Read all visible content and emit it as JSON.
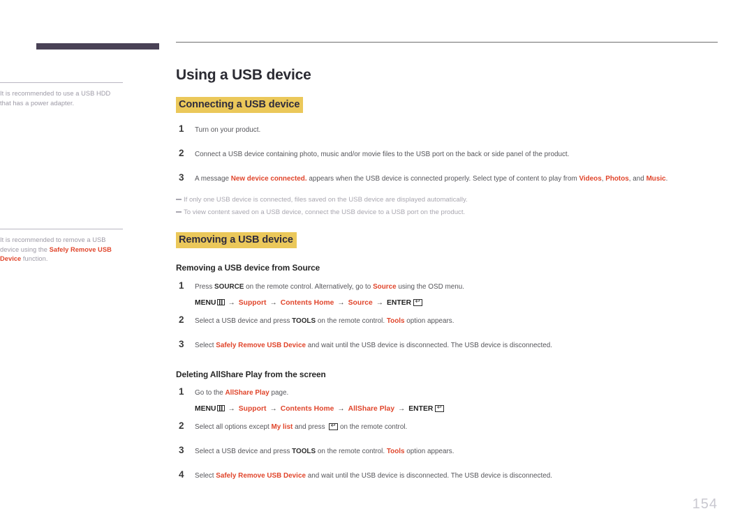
{
  "sidebar": {
    "notes": [
      {
        "id": "note-usb-hdd",
        "pre": "It is recommended to use a USB HDD that has a power adapter.",
        "accent": "",
        "post": ""
      },
      {
        "id": "note-safely-remove",
        "pre": "It is recommended to remove a USB device using the ",
        "accent": "Safely Remove USB Device",
        "post": " function."
      }
    ]
  },
  "page": {
    "title": "Using a USB device",
    "number": "154"
  },
  "sections": {
    "connecting": {
      "heading": "Connecting a USB device",
      "steps": [
        {
          "num": "1",
          "parts": [
            {
              "t": "Turn on your product.",
              "style": "plain"
            }
          ]
        },
        {
          "num": "2",
          "parts": [
            {
              "t": "Connect a USB device containing photo, music and/or movie files to the USB port on the back or side panel of the product.",
              "style": "plain"
            }
          ]
        },
        {
          "num": "3",
          "parts": [
            {
              "t": "A message ",
              "style": "plain"
            },
            {
              "t": "New device connected.",
              "style": "accent"
            },
            {
              "t": " appears when the USB device is connected properly. Select type of content to play from ",
              "style": "plain"
            },
            {
              "t": "Videos",
              "style": "accent"
            },
            {
              "t": ", ",
              "style": "plain"
            },
            {
              "t": "Photos",
              "style": "accent"
            },
            {
              "t": ", and ",
              "style": "plain"
            },
            {
              "t": "Music",
              "style": "accent"
            },
            {
              "t": ".",
              "style": "plain"
            }
          ]
        }
      ],
      "notes": [
        "If only one USB device is connected, files saved on the USB device are displayed automatically.",
        "To view content saved on a USB device, connect the USB device to a USB port on the product."
      ]
    },
    "removing": {
      "heading": "Removing a USB device",
      "subheading_source": "Removing a USB device from Source",
      "source_steps": [
        {
          "num": "1",
          "parts": [
            {
              "t": "Press ",
              "style": "plain"
            },
            {
              "t": "SOURCE",
              "style": "bold"
            },
            {
              "t": " on the remote control. Alternatively, go to ",
              "style": "plain"
            },
            {
              "t": "Source",
              "style": "accent"
            },
            {
              "t": " using the OSD menu.",
              "style": "plain"
            }
          ]
        },
        {
          "num": "2",
          "parts": [
            {
              "t": "Select a USB device and press ",
              "style": "plain"
            },
            {
              "t": "TOOLS",
              "style": "bold"
            },
            {
              "t": " on the remote control. ",
              "style": "plain"
            },
            {
              "t": "Tools",
              "style": "accent"
            },
            {
              "t": " option appears.",
              "style": "plain"
            }
          ]
        },
        {
          "num": "3",
          "parts": [
            {
              "t": "Select ",
              "style": "plain"
            },
            {
              "t": "Safely Remove USB Device",
              "style": "accent"
            },
            {
              "t": " and wait until the USB device is disconnected. The USB device is disconnected.",
              "style": "plain"
            }
          ]
        }
      ],
      "source_menupath": {
        "menu_label": "MENU",
        "items": [
          "Support",
          "Contents Home",
          "Source"
        ],
        "enter_label": "ENTER",
        "arrow": "→"
      },
      "subheading_allshare": "Deleting AllShare Play from the screen",
      "allshare_steps": [
        {
          "num": "1",
          "parts": [
            {
              "t": "Go to the ",
              "style": "plain"
            },
            {
              "t": "AllShare Play",
              "style": "accent"
            },
            {
              "t": " page.",
              "style": "plain"
            }
          ]
        },
        {
          "num": "2",
          "parts": [
            {
              "t": "Select all options except ",
              "style": "plain"
            },
            {
              "t": "My list",
              "style": "accent"
            },
            {
              "t": " and press ",
              "style": "plain"
            },
            {
              "t": "[ENTER-ICON]",
              "style": "enter-icon"
            },
            {
              "t": " on the remote control.",
              "style": "plain"
            }
          ]
        },
        {
          "num": "3",
          "parts": [
            {
              "t": "Select a USB device and press ",
              "style": "plain"
            },
            {
              "t": "TOOLS",
              "style": "bold"
            },
            {
              "t": " on the remote control. ",
              "style": "plain"
            },
            {
              "t": "Tools",
              "style": "accent"
            },
            {
              "t": " option appears.",
              "style": "plain"
            }
          ]
        },
        {
          "num": "4",
          "parts": [
            {
              "t": "Select ",
              "style": "plain"
            },
            {
              "t": "Safely Remove USB Device",
              "style": "accent"
            },
            {
              "t": " and wait until the USB device is disconnected. The USB device is disconnected.",
              "style": "plain"
            }
          ]
        }
      ],
      "allshare_menupath": {
        "menu_label": "MENU",
        "items": [
          "Support",
          "Contents Home",
          "AllShare Play"
        ],
        "enter_label": "ENTER",
        "arrow": "→"
      }
    }
  },
  "icons": {
    "menu_icon": "menu-grid-icon",
    "enter_icon": "enter-return-icon"
  },
  "colors": {
    "accent": "#e0452b",
    "highlight": "#ebc85a",
    "sidebar_bar": "#494256",
    "page_number": "#c9c8d0"
  }
}
